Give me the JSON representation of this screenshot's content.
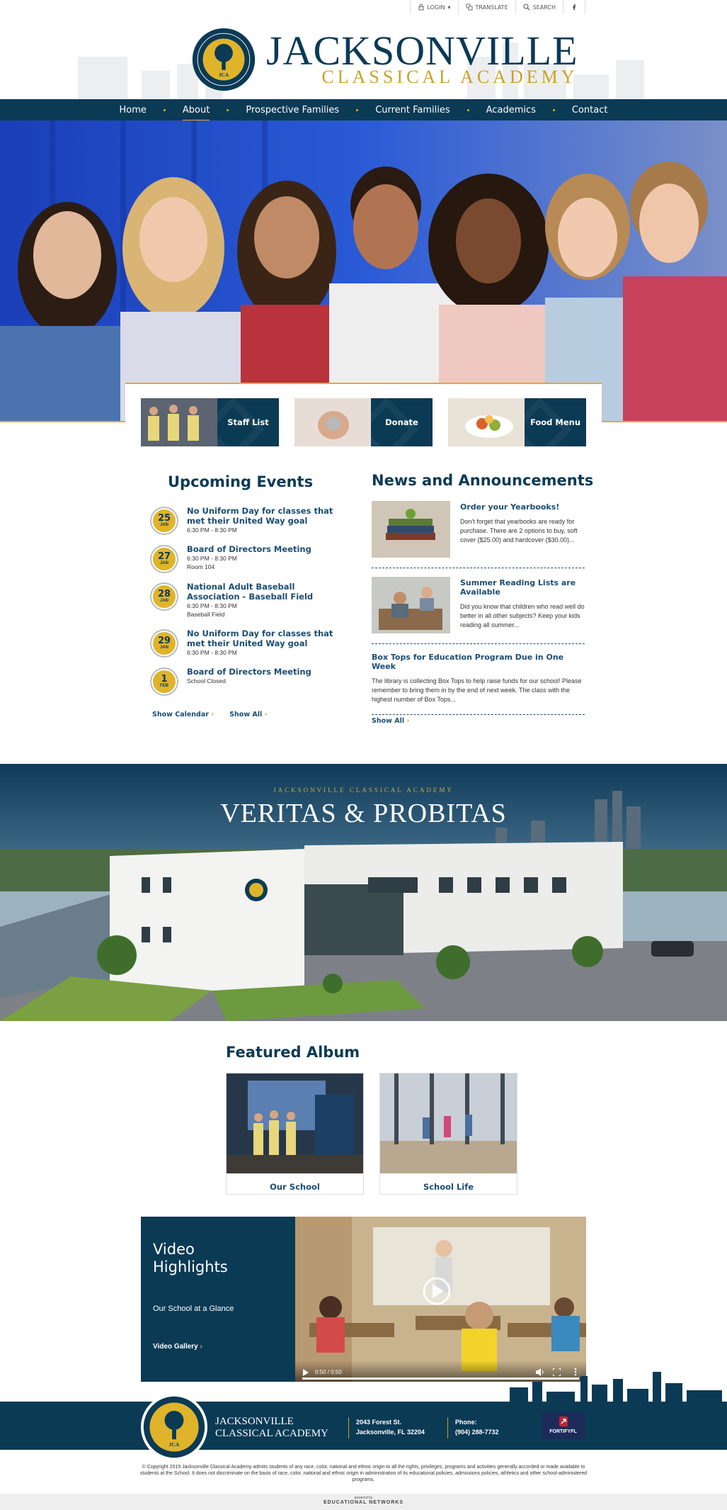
{
  "utility": {
    "login": "LOGIN",
    "translate": "TRANSLATE",
    "search": "SEARCH"
  },
  "brand": {
    "title": "JACKSONVILLE",
    "subtitle": "CLASSICAL ACADEMY",
    "seal_text": "JACKSONVILLE CLASSICAL ACADEMY",
    "seal_initials": "JCA",
    "seal_motto": "VERITAS & PROBITAS"
  },
  "nav": {
    "items": [
      "Home",
      "About",
      "Prospective Families",
      "Current Families",
      "Academics",
      "Contact"
    ],
    "active": "About"
  },
  "quick_links": [
    {
      "label": "Staff List"
    },
    {
      "label": "Donate"
    },
    {
      "label": "Food Menu"
    }
  ],
  "events": {
    "title": "Upcoming Events",
    "items": [
      {
        "day": "25",
        "month": "JAN",
        "title": "No Uniform Day for classes that met their United Way goal",
        "time": "6:30 PM - 8:30 PM",
        "location": ""
      },
      {
        "day": "27",
        "month": "JAN",
        "title": "Board of Directors Meeting",
        "time": "6:30 PM - 8:30 PM",
        "location": "Room 104"
      },
      {
        "day": "28",
        "month": "JAN",
        "title": "National Adult Baseball Association - Baseball Field",
        "time": "6:30 PM - 8:30 PM",
        "location": "Baseball Field"
      },
      {
        "day": "29",
        "month": "JAN",
        "title": "No Uniform Day for classes that met their United Way goal",
        "time": "6:30 PM - 8:30 PM",
        "location": ""
      },
      {
        "day": "1",
        "month": "FEB",
        "title": "Board of Directors Meeting",
        "time": "School Closed",
        "location": ""
      }
    ],
    "show_calendar": "Show Calendar",
    "show_all": "Show All"
  },
  "news": {
    "title": "News and Announcements",
    "items": [
      {
        "title": "Order your Yearbooks!",
        "desc": "Don't forget that yearbooks are ready for purchase. There are 2 options to buy, soft cover ($25.00) and hardcover ($30.00)..."
      },
      {
        "title": "Summer Reading Lists are Available",
        "desc": "Did you know that children who read well do better in all other subjects? Keep your kids reading all summer..."
      },
      {
        "title": "Box Tops for Education Program Due in One Week",
        "desc": "The library is collecting Box Tops to help raise funds for our school! Please remember to bring them in by the end of next week. The class with the highest number of Box Tops..."
      }
    ],
    "show_all": "Show All"
  },
  "banner": {
    "kicker": "JACKSONVILLE CLASSICAL ACADEMY",
    "motto": "VERITAS & PROBITAS"
  },
  "album": {
    "title": "Featured Album",
    "items": [
      {
        "label": "Our School"
      },
      {
        "label": "School Life"
      }
    ]
  },
  "video": {
    "title_line1": "Video",
    "title_line2": "Highlights",
    "subtitle": "Our School at a Glance",
    "gallery": "Video Gallery",
    "time": "0:50 / 0:50",
    "progress": 1.0
  },
  "footer": {
    "name_line1": "JACKSONVILLE",
    "name_line2": "CLASSICAL ACADEMY",
    "address_line1": "2043 Forest St.",
    "address_line2": "Jacksonville, FL 32204",
    "phone_label": "Phone:",
    "phone": "(904) 288-7732",
    "partner": "FORTIFYFL",
    "copyright": "© Copyright 2019 Jacksonville Classical Academy admits students of any race, color, national and ethnic origin to all the rights, privileges, programs and activities generally accorded or made available to students at the School. It does not discriminate on the basis of race, color, national and ethnic origin in administration of its educational policies, admissions policies, athletics and other school-administered programs.",
    "powered_by": "powered by",
    "provider": "EDUCATIONAL NETWORKS"
  },
  "colors": {
    "navy": "#0b3a55",
    "gold": "#e6a92a",
    "link": "#1b4d73"
  }
}
